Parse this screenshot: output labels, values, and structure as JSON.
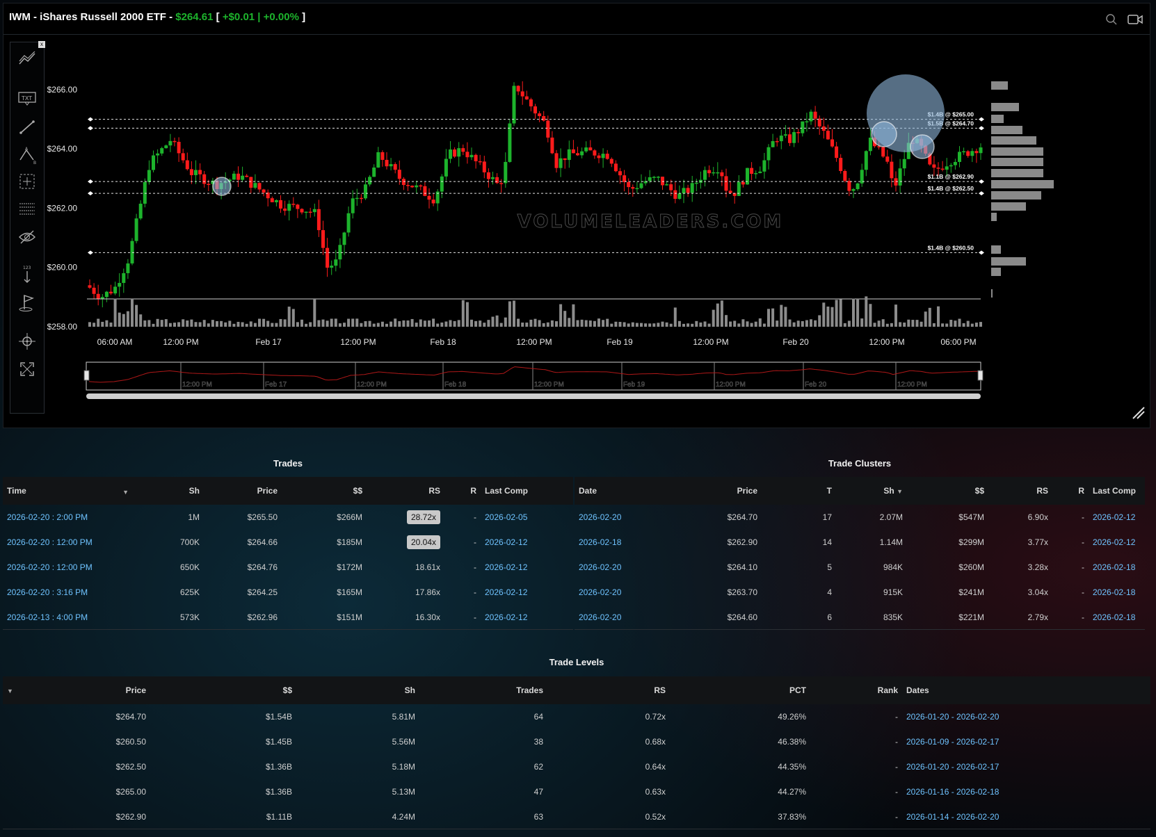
{
  "header": {
    "title": "IWM - iShares Russell 2000 ETF -",
    "price": "$264.61",
    "bracket_open": "[",
    "change": "+$0.01 | +0.00%",
    "bracket_close": "]",
    "icons": [
      "zoom-icon",
      "video-icon"
    ]
  },
  "toolbar": {
    "close_label": "x",
    "tools": [
      "trend-lines-icon",
      "text-annotation-icon",
      "line-draw-icon",
      "pattern-abc-icon",
      "crosshair-box-icon",
      "horizontal-lines-icon",
      "hide-eye-icon",
      "measure-icon",
      "flag-icon",
      "zoom-target-icon",
      "expand-icon"
    ]
  },
  "chart": {
    "watermark": "VOLUMELEADERS.COM",
    "y_ticks": [
      "$266.00",
      "$264.00",
      "$262.00",
      "$260.00",
      "$258.00"
    ],
    "x_ticks": [
      "06:00 AM",
      "12:00 PM",
      "Feb 17",
      "12:00 PM",
      "Feb 18",
      "12:00 PM",
      "Feb 19",
      "12:00 PM",
      "Feb 20",
      "12:00 PM",
      "06:00 PM"
    ],
    "navigator_labels": [
      "12:00 PM",
      "Feb 17",
      "12:00 PM",
      "Feb 18",
      "12:00 PM",
      "Feb 19",
      "12:00 PM",
      "Feb 20",
      "12:00 PM"
    ],
    "level_labels": [
      "$1.4B @ $265.00",
      "$1.5B @ $264.70",
      "$1.1B @ $262.90",
      "$1.4B @ $262.50",
      "$1.4B @ $260.50"
    ],
    "colors": {
      "up": "#1db32c",
      "down": "#ff1b1b",
      "bubble": "#8fb7dc",
      "volume": "#8c8c8c"
    }
  },
  "trades": {
    "title": "Trades",
    "columns": [
      "Time",
      "Sh",
      "Price",
      "$$",
      "RS",
      "R",
      "Last Comp"
    ],
    "rows": [
      {
        "time": "2026-02-20 : 2:00 PM",
        "sh": "1M",
        "price": "$265.50",
        "dollars": "$266M",
        "rs": "28.72x",
        "rs_badge": true,
        "r": "-",
        "last_comp": "2026-02-05"
      },
      {
        "time": "2026-02-20 : 12:00 PM",
        "sh": "700K",
        "price": "$264.66",
        "dollars": "$185M",
        "rs": "20.04x",
        "rs_badge": true,
        "r": "-",
        "last_comp": "2026-02-12"
      },
      {
        "time": "2026-02-20 : 12:00 PM",
        "sh": "650K",
        "price": "$264.76",
        "dollars": "$172M",
        "rs": "18.61x",
        "rs_badge": false,
        "r": "-",
        "last_comp": "2026-02-12"
      },
      {
        "time": "2026-02-20 : 3:16 PM",
        "sh": "625K",
        "price": "$264.25",
        "dollars": "$165M",
        "rs": "17.86x",
        "rs_badge": false,
        "r": "-",
        "last_comp": "2026-02-12"
      },
      {
        "time": "2026-02-13 : 4:00 PM",
        "sh": "573K",
        "price": "$262.96",
        "dollars": "$151M",
        "rs": "16.30x",
        "rs_badge": false,
        "r": "-",
        "last_comp": "2026-02-12"
      }
    ]
  },
  "clusters": {
    "title": "Trade Clusters",
    "columns": [
      "Date",
      "Price",
      "T",
      "Sh",
      "$$",
      "RS",
      "R",
      "Last Comp"
    ],
    "rows": [
      {
        "date": "2026-02-20",
        "price": "$264.70",
        "t": "17",
        "sh": "2.07M",
        "dollars": "$547M",
        "rs": "6.90x",
        "r": "-",
        "last_comp": "2026-02-12"
      },
      {
        "date": "2026-02-18",
        "price": "$262.90",
        "t": "14",
        "sh": "1.14M",
        "dollars": "$299M",
        "rs": "3.77x",
        "r": "-",
        "last_comp": "2026-02-12"
      },
      {
        "date": "2026-02-20",
        "price": "$264.10",
        "t": "5",
        "sh": "984K",
        "dollars": "$260M",
        "rs": "3.28x",
        "r": "-",
        "last_comp": "2026-02-18"
      },
      {
        "date": "2026-02-20",
        "price": "$263.70",
        "t": "4",
        "sh": "915K",
        "dollars": "$241M",
        "rs": "3.04x",
        "r": "-",
        "last_comp": "2026-02-18"
      },
      {
        "date": "2026-02-20",
        "price": "$264.60",
        "t": "6",
        "sh": "835K",
        "dollars": "$221M",
        "rs": "2.79x",
        "r": "-",
        "last_comp": "2026-02-18"
      }
    ]
  },
  "levels": {
    "title": "Trade Levels",
    "columns": [
      "Price",
      "$$",
      "Sh",
      "Trades",
      "RS",
      "PCT",
      "Rank",
      "Dates"
    ],
    "rows": [
      {
        "price": "$264.70",
        "dollars": "$1.54B",
        "sh": "5.81M",
        "trades": "64",
        "rs": "0.72x",
        "pct": "49.26%",
        "rank": "-",
        "dates": "2026-01-20 - 2026-02-20"
      },
      {
        "price": "$260.50",
        "dollars": "$1.45B",
        "sh": "5.56M",
        "trades": "38",
        "rs": "0.68x",
        "pct": "46.38%",
        "rank": "-",
        "dates": "2026-01-09 - 2026-02-17"
      },
      {
        "price": "$262.50",
        "dollars": "$1.36B",
        "sh": "5.18M",
        "trades": "62",
        "rs": "0.64x",
        "pct": "44.35%",
        "rank": "-",
        "dates": "2026-01-20 - 2026-02-17"
      },
      {
        "price": "$265.00",
        "dollars": "$1.36B",
        "sh": "5.13M",
        "trades": "47",
        "rs": "0.63x",
        "pct": "44.27%",
        "rank": "-",
        "dates": "2026-01-16 - 2026-02-18"
      },
      {
        "price": "$262.90",
        "dollars": "$1.11B",
        "sh": "4.24M",
        "trades": "63",
        "rs": "0.52x",
        "pct": "37.83%",
        "rank": "-",
        "dates": "2026-01-14 - 2026-02-20"
      }
    ]
  }
}
